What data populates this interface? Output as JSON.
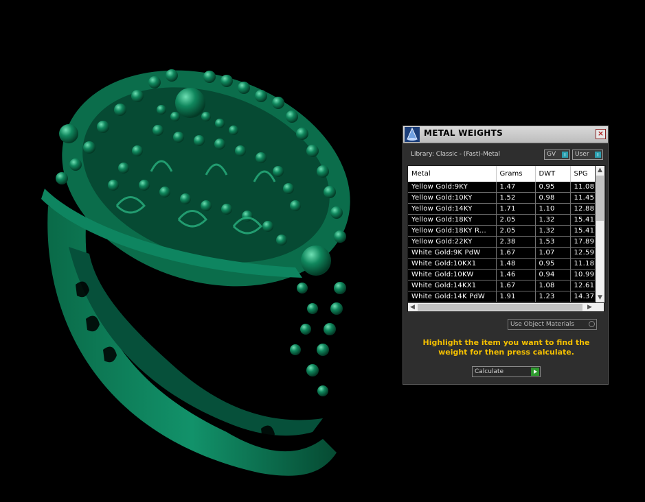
{
  "panel": {
    "title": "METAL WEIGHTS",
    "library_label": "Library: Classic - (Fast)-Metal",
    "toggles": [
      {
        "label": "GV",
        "state": "on"
      },
      {
        "label": "User",
        "state": "on"
      }
    ],
    "columns": [
      "Metal",
      "Grams",
      "DWT",
      "SPG"
    ],
    "rows": [
      {
        "metal": "Yellow Gold:9KY",
        "grams": "1.47",
        "dwt": "0.95",
        "spg": "11.08"
      },
      {
        "metal": "Yellow Gold:10KY",
        "grams": "1.52",
        "dwt": "0.98",
        "spg": "11.45"
      },
      {
        "metal": "Yellow Gold:14KY",
        "grams": "1.71",
        "dwt": "1.10",
        "spg": "12.88"
      },
      {
        "metal": "Yellow Gold:18KY",
        "grams": "2.05",
        "dwt": "1.32",
        "spg": "15.41"
      },
      {
        "metal": "Yellow Gold:18KY R...",
        "grams": "2.05",
        "dwt": "1.32",
        "spg": "15.41"
      },
      {
        "metal": "Yellow Gold:22KY",
        "grams": "2.38",
        "dwt": "1.53",
        "spg": "17.89"
      },
      {
        "metal": "White Gold:9K PdW",
        "grams": "1.67",
        "dwt": "1.07",
        "spg": "12.59"
      },
      {
        "metal": "White Gold:10KX1",
        "grams": "1.48",
        "dwt": "0.95",
        "spg": "11.18"
      },
      {
        "metal": "White Gold:10KW",
        "grams": "1.46",
        "dwt": "0.94",
        "spg": "10.99"
      },
      {
        "metal": "White Gold:14KX1",
        "grams": "1.67",
        "dwt": "1.08",
        "spg": "12.61"
      },
      {
        "metal": "White Gold:14K PdW",
        "grams": "1.91",
        "dwt": "1.23",
        "spg": "14.37"
      }
    ],
    "use_object_materials_label": "Use Object Materials",
    "instructions": "Highlight the item you want to find the weight for then press calculate.",
    "calculate_label": "Calculate",
    "colors": {
      "accent": "#2b9fb0",
      "instruction_text": "#f5c000",
      "go_button": "#2f9a2f",
      "model": "#0b7a55"
    },
    "icons": {
      "title": "app-cone-icon",
      "close": "close-icon",
      "scroll_up": "arrow-up-icon",
      "scroll_down": "arrow-down-icon",
      "scroll_left": "arrow-left-icon",
      "scroll_right": "arrow-right-icon",
      "calculate": "play-icon"
    }
  }
}
